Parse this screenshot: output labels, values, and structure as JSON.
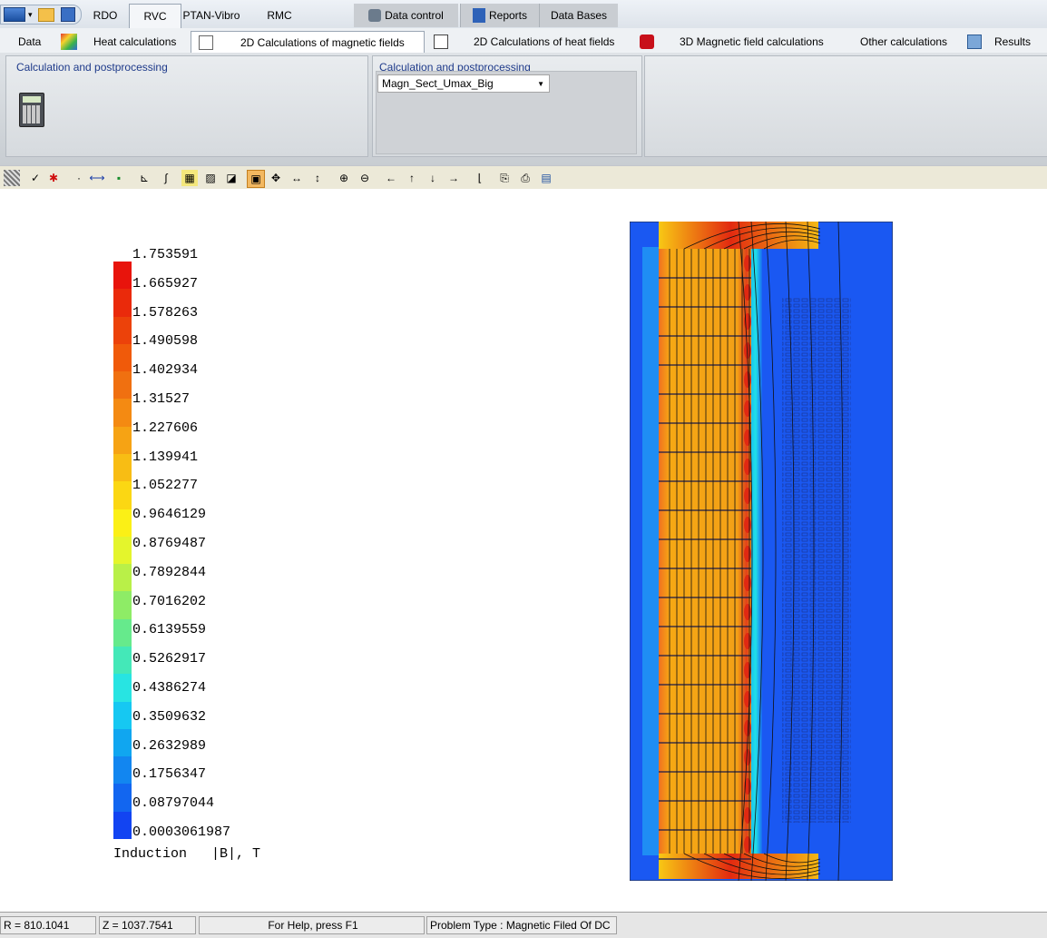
{
  "top_tabs": [
    "RDO",
    "RVC",
    "PTAN-Vibro",
    "RMC"
  ],
  "top_right_tabs": [
    "Data control",
    "Reports",
    "Data Bases"
  ],
  "ribbon_tabs": [
    "Data",
    "Heat calculations",
    "2D Calculations of magnetic fields",
    "2D Calculations of heat fields",
    "3D Magnetic field calculations",
    "Other calculations",
    "Results"
  ],
  "groups": {
    "left_title": "Calculation and postprocessing",
    "right_title": "Calculation and postprocessing",
    "select_value": "Magn_Sect_Umax_Big"
  },
  "legend": {
    "values": [
      "1.753591",
      "1.665927",
      "1.578263",
      "1.490598",
      "1.402934",
      "1.31527",
      "1.227606",
      "1.139941",
      "1.052277",
      "0.9646129",
      "0.8769487",
      "0.7892844",
      "0.7016202",
      "0.6139559",
      "0.5262917",
      "0.4386274",
      "0.3509632",
      "0.2632989",
      "0.1756347",
      "0.08797044",
      "0.0003061987"
    ],
    "caption": "Induction   |B|, T"
  },
  "colors": {
    "scale": [
      "#e8140c",
      "#ea2a0b",
      "#ec420a",
      "#f05a0a",
      "#f07010",
      "#f48a12",
      "#f6a314",
      "#f8bd14",
      "#fbd713",
      "#fbf016",
      "#e4f52c",
      "#b9f048",
      "#8eec66",
      "#66ea8c",
      "#44e8b8",
      "#28e4e2",
      "#16c8f2",
      "#10a6f0",
      "#1286f0",
      "#1266f0",
      "#1244f2"
    ],
    "field_background": "#1a58f2"
  },
  "status": {
    "r": "R = 810.1041",
    "z": "Z = 1037.7541",
    "help": "For Help, press F1",
    "problem": "Problem Type :  Magnetic Filed Of DC"
  }
}
